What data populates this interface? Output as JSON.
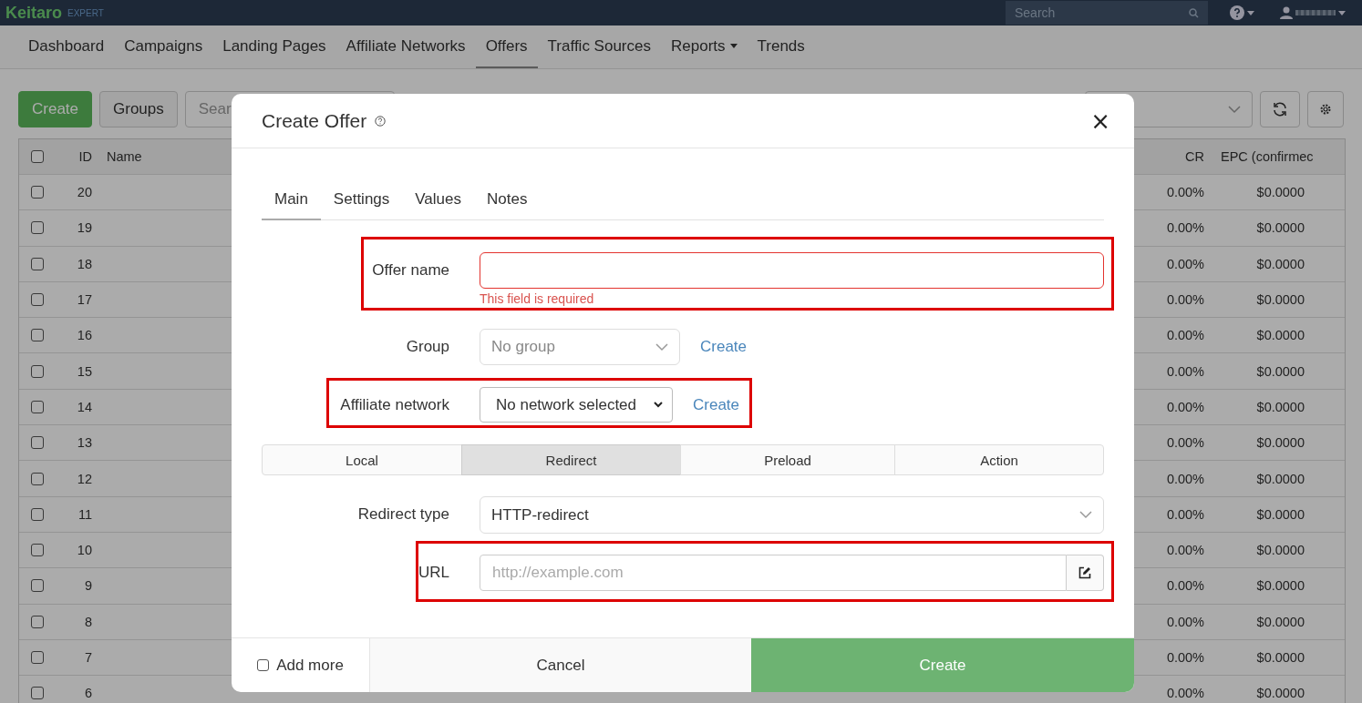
{
  "topbar": {
    "logo": "Keitaro",
    "edition": "EXPERT",
    "search": {
      "placeholder": "Search"
    }
  },
  "nav": [
    {
      "label": "Dashboard",
      "kind": "link",
      "selected": false
    },
    {
      "label": "Campaigns",
      "kind": "link",
      "selected": false
    },
    {
      "label": "Landing Pages",
      "kind": "link",
      "selected": false
    },
    {
      "label": "Affiliate Networks",
      "kind": "link",
      "selected": false
    },
    {
      "label": "Offers",
      "kind": "link",
      "selected": true
    },
    {
      "label": "Traffic Sources",
      "kind": "link",
      "selected": false
    },
    {
      "label": "Reports",
      "kind": "dropdown",
      "selected": false
    },
    {
      "label": "Trends",
      "kind": "link",
      "selected": false
    }
  ],
  "toolbar": {
    "buttons": [
      {
        "label": "Create",
        "kind": "primary"
      },
      {
        "label": "Groups",
        "kind": "default"
      }
    ],
    "search": {
      "placeholder": "Sear"
    }
  },
  "table": {
    "select_all": {
      "checked": false
    },
    "columns": [
      {
        "label": "ID"
      },
      {
        "label": "Name"
      },
      {
        "label": "CR"
      },
      {
        "label": "EPC (confirmec"
      }
    ],
    "rows": [
      {
        "checked": false,
        "id": "20",
        "cr": "0.00%",
        "epc": "$0.0000"
      },
      {
        "checked": false,
        "id": "19",
        "cr": "0.00%",
        "epc": "$0.0000"
      },
      {
        "checked": false,
        "id": "18",
        "cr": "0.00%",
        "epc": "$0.0000"
      },
      {
        "checked": false,
        "id": "17",
        "cr": "0.00%",
        "epc": "$0.0000"
      },
      {
        "checked": false,
        "id": "16",
        "cr": "0.00%",
        "epc": "$0.0000"
      },
      {
        "checked": false,
        "id": "15",
        "cr": "0.00%",
        "epc": "$0.0000"
      },
      {
        "checked": false,
        "id": "14",
        "cr": "0.00%",
        "epc": "$0.0000"
      },
      {
        "checked": false,
        "id": "13",
        "cr": "0.00%",
        "epc": "$0.0000"
      },
      {
        "checked": false,
        "id": "12",
        "cr": "0.00%",
        "epc": "$0.0000"
      },
      {
        "checked": false,
        "id": "11",
        "cr": "0.00%",
        "epc": "$0.0000"
      },
      {
        "checked": false,
        "id": "10",
        "cr": "0.00%",
        "epc": "$0.0000"
      },
      {
        "checked": false,
        "id": "9",
        "cr": "0.00%",
        "epc": "$0.0000"
      },
      {
        "checked": false,
        "id": "8",
        "cr": "0.00%",
        "epc": "$0.0000"
      },
      {
        "checked": false,
        "id": "7",
        "cr": "0.00%",
        "epc": "$0.0000"
      },
      {
        "checked": false,
        "id": "6",
        "cr": "0.00%",
        "epc": "$0.0000"
      }
    ]
  },
  "modal": {
    "title": "Create Offer",
    "close": "×",
    "tabs": [
      {
        "label": "Main",
        "selected": true
      },
      {
        "label": "Settings",
        "selected": false
      },
      {
        "label": "Values",
        "selected": false
      },
      {
        "label": "Notes",
        "selected": false
      }
    ],
    "form": [
      {
        "kind": "text",
        "label": "Offer name",
        "highlighted": true,
        "error": "This field is required"
      },
      {
        "kind": "select",
        "label": "Group",
        "highlighted": false,
        "placeholder": "No group",
        "link": "Create"
      },
      {
        "kind": "native-select",
        "label": "Affiliate network",
        "highlighted": true,
        "value": "No network selected",
        "link": "Create"
      },
      {
        "kind": "segmented",
        "highlighted": false,
        "options": [
          {
            "label": "Local",
            "selected": false
          },
          {
            "label": "Redirect",
            "selected": true
          },
          {
            "label": "Preload",
            "selected": false
          },
          {
            "label": "Action",
            "selected": false
          }
        ]
      },
      {
        "kind": "wide-select",
        "label": "Redirect type",
        "highlighted": false,
        "value": "HTTP-redirect"
      },
      {
        "kind": "url",
        "label": "URL",
        "highlighted": true,
        "placeholder": "http://example.com"
      }
    ],
    "footer": {
      "add_more": {
        "label": "Add more",
        "checked": false
      },
      "cancel": "Cancel",
      "create": "Create"
    }
  }
}
